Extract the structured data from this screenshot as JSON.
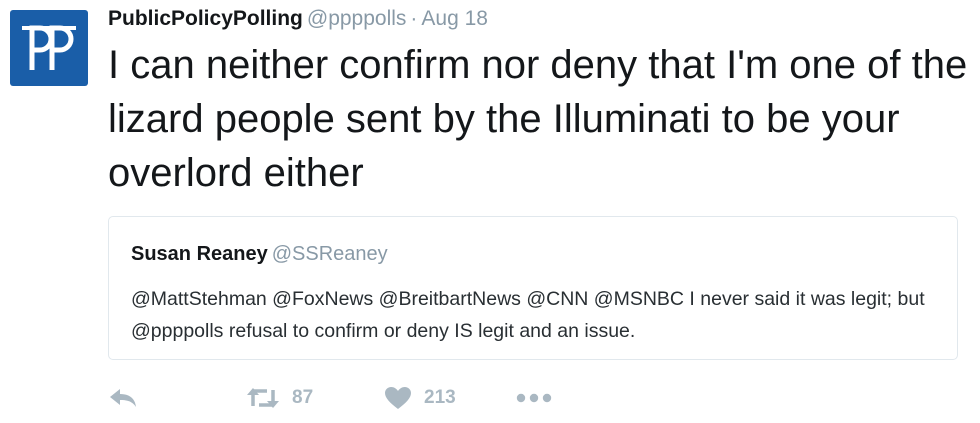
{
  "tweet": {
    "author_name": "PublicPolicyPolling",
    "handle": "@ppppolls",
    "separator": "·",
    "date": "Aug 18",
    "text": "I can neither confirm nor deny that I'm one of the lizard people sent by the Illuminati to be your overlord either",
    "avatar_icon": "ppp-logo-icon"
  },
  "quoted_tweet": {
    "author_name": "Susan Reaney",
    "handle": "@SSReaney",
    "text": "@MattStehman @FoxNews @BreitbartNews @CNN @MSNBC I never said it was legit; but @ppppolls refusal to confirm or deny IS legit and an issue."
  },
  "actions": {
    "reply_icon": "reply-icon",
    "retweet_icon": "retweet-icon",
    "retweet_count": "87",
    "like_icon": "heart-icon",
    "like_count": "213",
    "more_icon": "more-dots-icon"
  },
  "colors": {
    "brand_blue": "#1a5ea8",
    "muted_gray": "#8899a6",
    "icon_gray": "#aab8c2",
    "border": "#e1e8ed"
  }
}
